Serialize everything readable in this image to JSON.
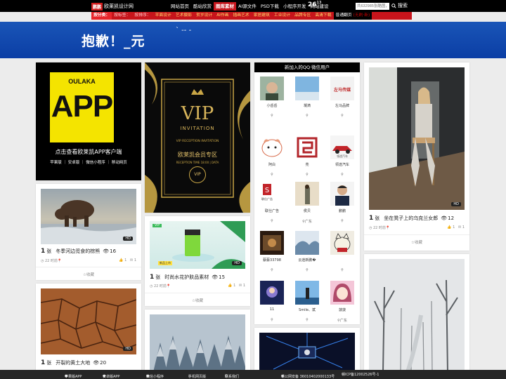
{
  "header": {
    "logo_mark": "鹏鹏",
    "logo_text": "欧莱凯设计网",
    "nav": [
      "网站首页",
      "酷站欣赏",
      "图库素材",
      "AI源文件",
      "PSD下载",
      "小程序开发",
      "网站建设"
    ],
    "counter": "26",
    "counter_sup": "13",
    "search_placeholder": "共632985张酷图，请！",
    "search_label": "搜索"
  },
  "categories": {
    "head": "按分类：",
    "items": [
      "按标签：",
      "按排序："
    ],
    "gold": [
      "平面设计",
      "艺术摄影",
      "贺岁设计",
      "AI作画",
      "插画艺术",
      "家居建筑",
      "工业设计",
      "品牌专区",
      "高清下载"
    ],
    "last": "普通翻页",
    "last_dim": "(无刷·新)"
  },
  "banner": {
    "text": "抱歉！_元",
    "dots": "` -- -"
  },
  "app_card": {
    "brand": "OULAKA",
    "word": "APP",
    "line": "点击查看欧莱凯APP客户端",
    "links": "苹果版 ｜ 安卓版 ｜ 微信小程序 ｜ 移动网页"
  },
  "vip_card": {
    "vip": "VIP",
    "invitation": "INVITATION",
    "reception": "VIP RECEPTION INVITATION",
    "title": "欧莱凯会员专区",
    "subtitle": "RECEPTION TIME 18:00 | DATA",
    "badge": "VIP"
  },
  "cards": [
    {
      "count": "1",
      "unit": "张",
      "title": "冬季河边觅食的棕熊",
      "views": "16",
      "time": "22 时前",
      "likes": "1",
      "comments": "1",
      "collect": "☆收藏"
    },
    {
      "count": "1",
      "unit": "张",
      "title": "时尚水花护肤品素材",
      "views": "15",
      "time": "22 时前",
      "likes": "1",
      "comments": "1",
      "collect": "☆收藏"
    },
    {
      "count": "1",
      "unit": "张",
      "title": "坐在凳子上的乌克兰女郎",
      "views": "12",
      "time": "22 时前",
      "likes": "1",
      "comments": "1",
      "collect": "☆收藏"
    },
    {
      "count": "1",
      "unit": "张",
      "title": "开裂的黄土大地",
      "views": "20"
    }
  ],
  "badges": {
    "hd": "HD",
    "vip_tag": "VIP",
    "new_tag": "新品上市"
  },
  "panel": {
    "title": "新加入的QQ·微信用户",
    "users": [
      {
        "name": "小岳岳",
        "loc": ""
      },
      {
        "name": "凝滴",
        "loc": ""
      },
      {
        "name": "左马品牌",
        "loc": ""
      },
      {
        "name": "阿白",
        "loc": ""
      },
      {
        "name": "亮",
        "loc": ""
      },
      {
        "name": "领途汽车",
        "loc": ""
      },
      {
        "name": "联仕广告",
        "loc": ""
      },
      {
        "name": "侯贝",
        "loc": "广东"
      },
      {
        "name": "鹏鹏",
        "loc": ""
      },
      {
        "name": "蔡蔡33798",
        "loc": ""
      },
      {
        "name": "云途新鹏�",
        "loc": ""
      },
      {
        "name": "",
        "loc": ""
      },
      {
        "name": "11",
        "loc": ""
      },
      {
        "name": "Smile、斌",
        "loc": ""
      },
      {
        "name": "菠菠",
        "loc": "广东"
      }
    ],
    "logo_texts": {
      "u3": "左马传媒",
      "u6": "领途汽车",
      "u7": "联仕广告"
    }
  },
  "footer": {
    "items": [
      "苹果版APP",
      "安卓版APP",
      "微信小程序",
      "手机网页版",
      "联系我们"
    ],
    "police": "赣公网安备 36010402000133号",
    "icp": "赣ICP备12002526号-1"
  }
}
